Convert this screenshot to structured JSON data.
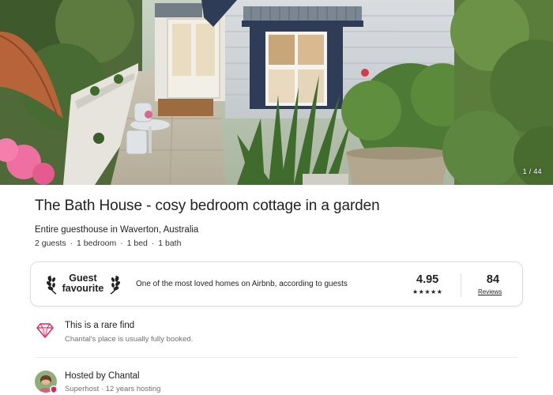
{
  "hero": {
    "photo_counter": "1 / 44"
  },
  "listing": {
    "title": "The Bath House - cosy bedroom cottage in a garden",
    "subtitle": "Entire guesthouse in Waverton, Australia",
    "details": [
      "2 guests",
      "1 bedroom",
      "1 bed",
      "1 bath"
    ],
    "details_separator": "·"
  },
  "guest_favourite": {
    "label_line1": "Guest",
    "label_line2": "favourite",
    "description": "One of the most loved homes on Airbnb, according to guests",
    "rating": "4.95",
    "stars": "★★★★★",
    "reviews_count": "84",
    "reviews_label": "Reviews"
  },
  "rare_find": {
    "icon": "diamond-icon",
    "title": "This is a rare find",
    "subtitle": "Chantal's place is usually fully booked."
  },
  "host": {
    "title": "Hosted by Chantal",
    "subtitle": "Superhost · 12 years hosting"
  },
  "colors": {
    "brand": "#FF385C",
    "text": "#222222",
    "muted": "#717171",
    "border": "#DDDDDD"
  }
}
